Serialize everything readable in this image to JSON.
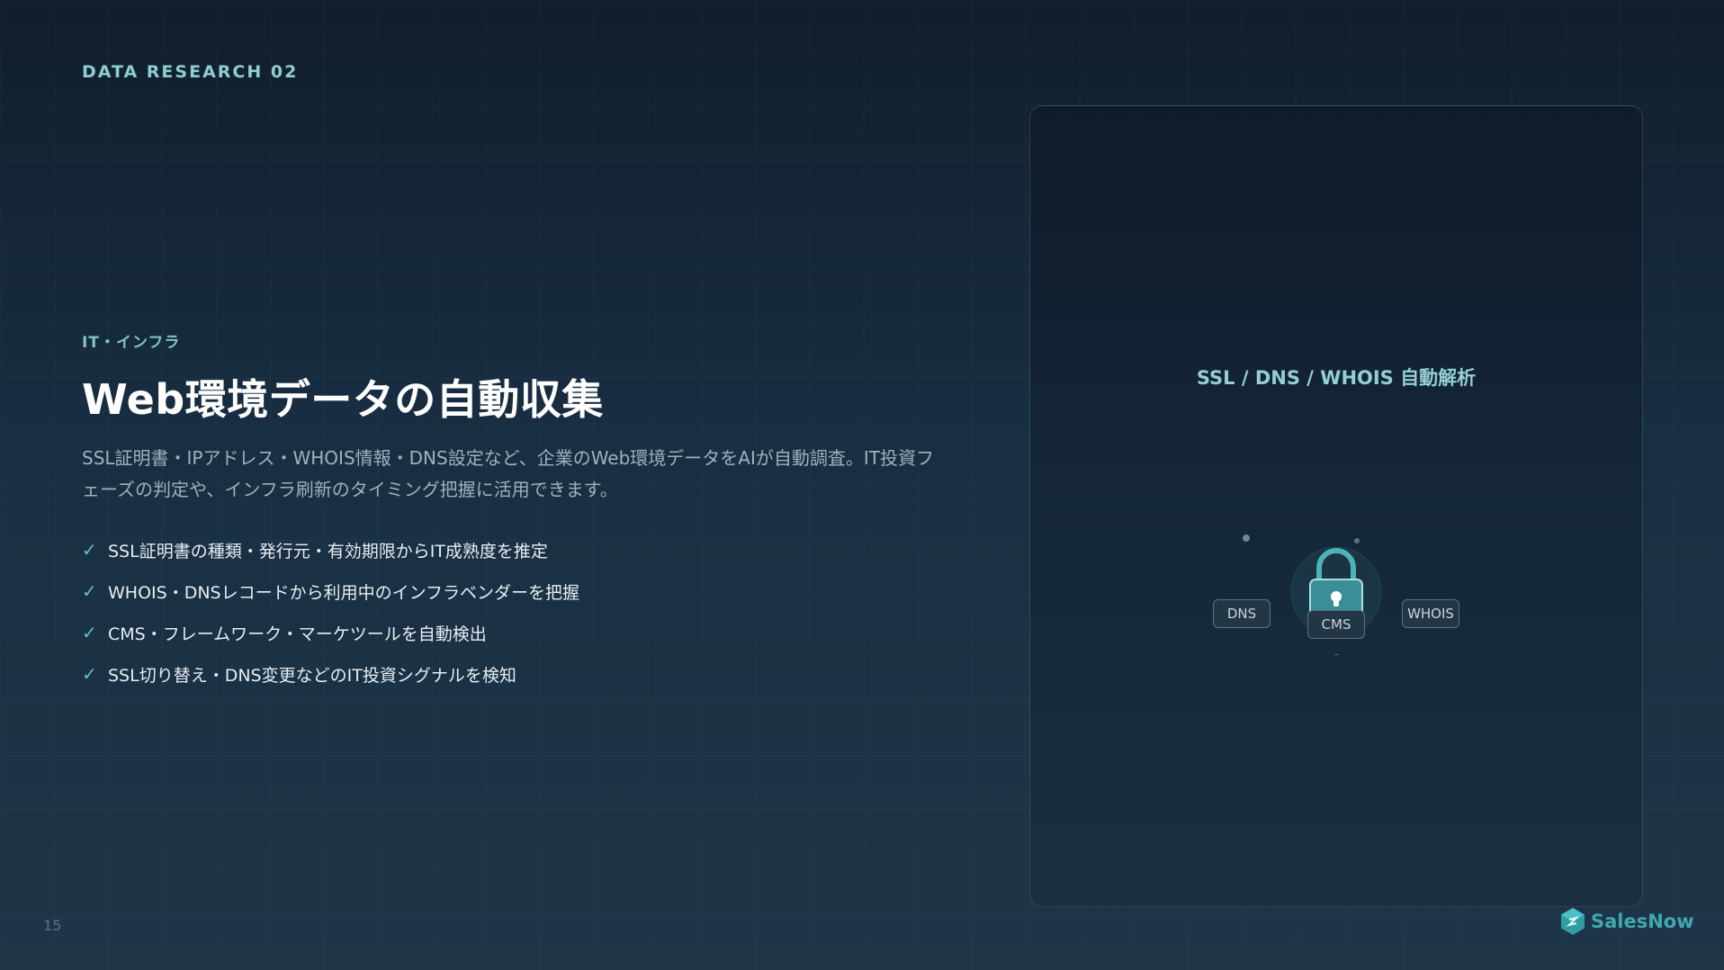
{
  "header": {
    "eyebrow": "DATA RESEARCH 02"
  },
  "main": {
    "category": "IT・インフラ",
    "title": "Web環境データの自動収集",
    "description": "SSL証明書・IPアドレス・WHOIS情報・DNS設定など、企業のWeb環境データをAIが自動調査。IT投資フェーズの判定や、インフラ刷新のタイミング把握に活用できます。",
    "bullets": [
      "SSL証明書の種類・発行元・有効期限からIT成熟度を推定",
      "WHOIS・DNSレコードから利用中のインフラベンダーを把握",
      "CMS・フレームワーク・マーケツールを自動検出",
      "SSL切り替え・DNS変更などのIT投資シグナルを検知"
    ],
    "check_mark": "✓"
  },
  "card": {
    "title": "SSL / DNS / WHOIS 自動解析",
    "center_icon": "lock-icon",
    "nodes": [
      "DNS",
      "CMS",
      "WHOIS"
    ]
  },
  "footer": {
    "page_number": "15",
    "brand": "SalesNow",
    "brand_icon": "hexagon-logo-icon"
  },
  "colors": {
    "accent": "#5fc1c4",
    "brand": "#3fa9ad",
    "title": "#ffffff",
    "card_title": "#95cfd2"
  }
}
